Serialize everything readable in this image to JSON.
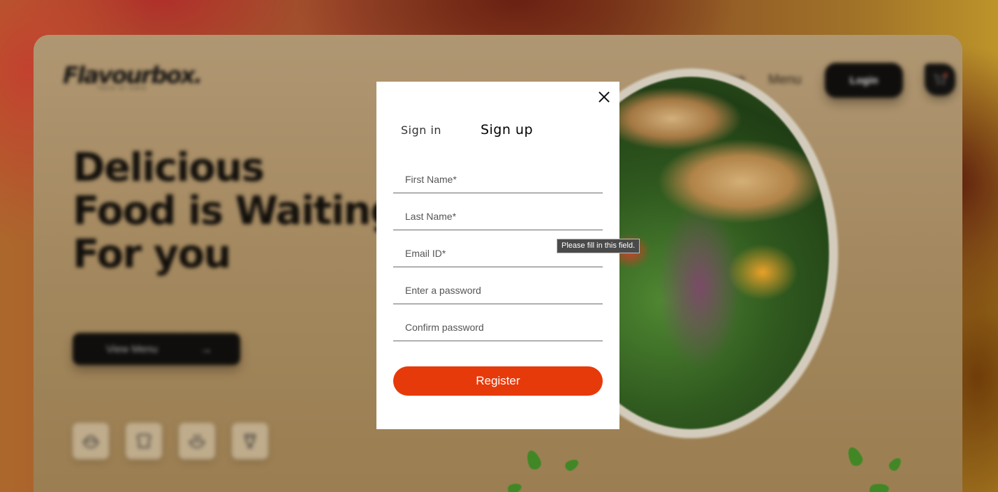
{
  "colors": {
    "accent": "#e63a0b",
    "modal_background": "#ffffff",
    "button_dark": "#0a0a0a"
  },
  "background": {
    "logo": {
      "text": "Flavourbox.",
      "tagline": "Taste of India"
    },
    "nav": {
      "home": "Home",
      "menu": "Menu",
      "login": "Login",
      "cart_icon": "cart-icon"
    },
    "hero": {
      "lines": [
        "Delicious",
        "Food is Waiting",
        "For you"
      ]
    },
    "view_menu_button": {
      "label": "View Menu",
      "arrow": "→"
    },
    "categories": [
      {
        "icon": "rice-bowl-icon"
      },
      {
        "icon": "bread-icon"
      },
      {
        "icon": "soup-bowl-icon"
      },
      {
        "icon": "drink-glass-icon"
      }
    ]
  },
  "modal": {
    "tabs": {
      "signin": "Sign in",
      "signup": "Sign up",
      "active": "signup"
    },
    "fields": {
      "first_name": {
        "placeholder": "First Name*",
        "value": ""
      },
      "last_name": {
        "placeholder": "Last Name*",
        "value": ""
      },
      "email": {
        "placeholder": "Email ID*",
        "value": ""
      },
      "password": {
        "placeholder": "Enter a password",
        "value": ""
      },
      "confirm_password": {
        "placeholder": "Confirm password",
        "value": ""
      }
    },
    "register_label": "Register",
    "close_icon": "close-icon"
  },
  "tooltip": {
    "text": "Please fill in this field."
  }
}
